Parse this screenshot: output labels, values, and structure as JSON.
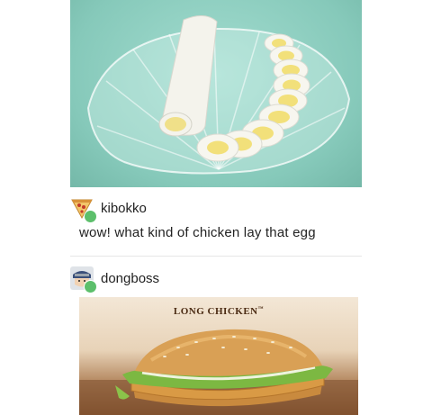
{
  "posts": [
    {
      "username": "kibokko",
      "text": "wow! what kind of chicken lay that egg"
    },
    {
      "username": "dongboss",
      "ad_title": "LONG CHICKEN",
      "ad_title_mark": "™"
    }
  ],
  "colors": {
    "photo_bg": "#86c9ba",
    "egg_white": "#f4f3ec",
    "yolk": "#f2e07a",
    "badge": "#5cbf6b"
  },
  "icons": {
    "avatar_1": "pizza-slice-avatar",
    "avatar_2": "ninja-avatar"
  }
}
